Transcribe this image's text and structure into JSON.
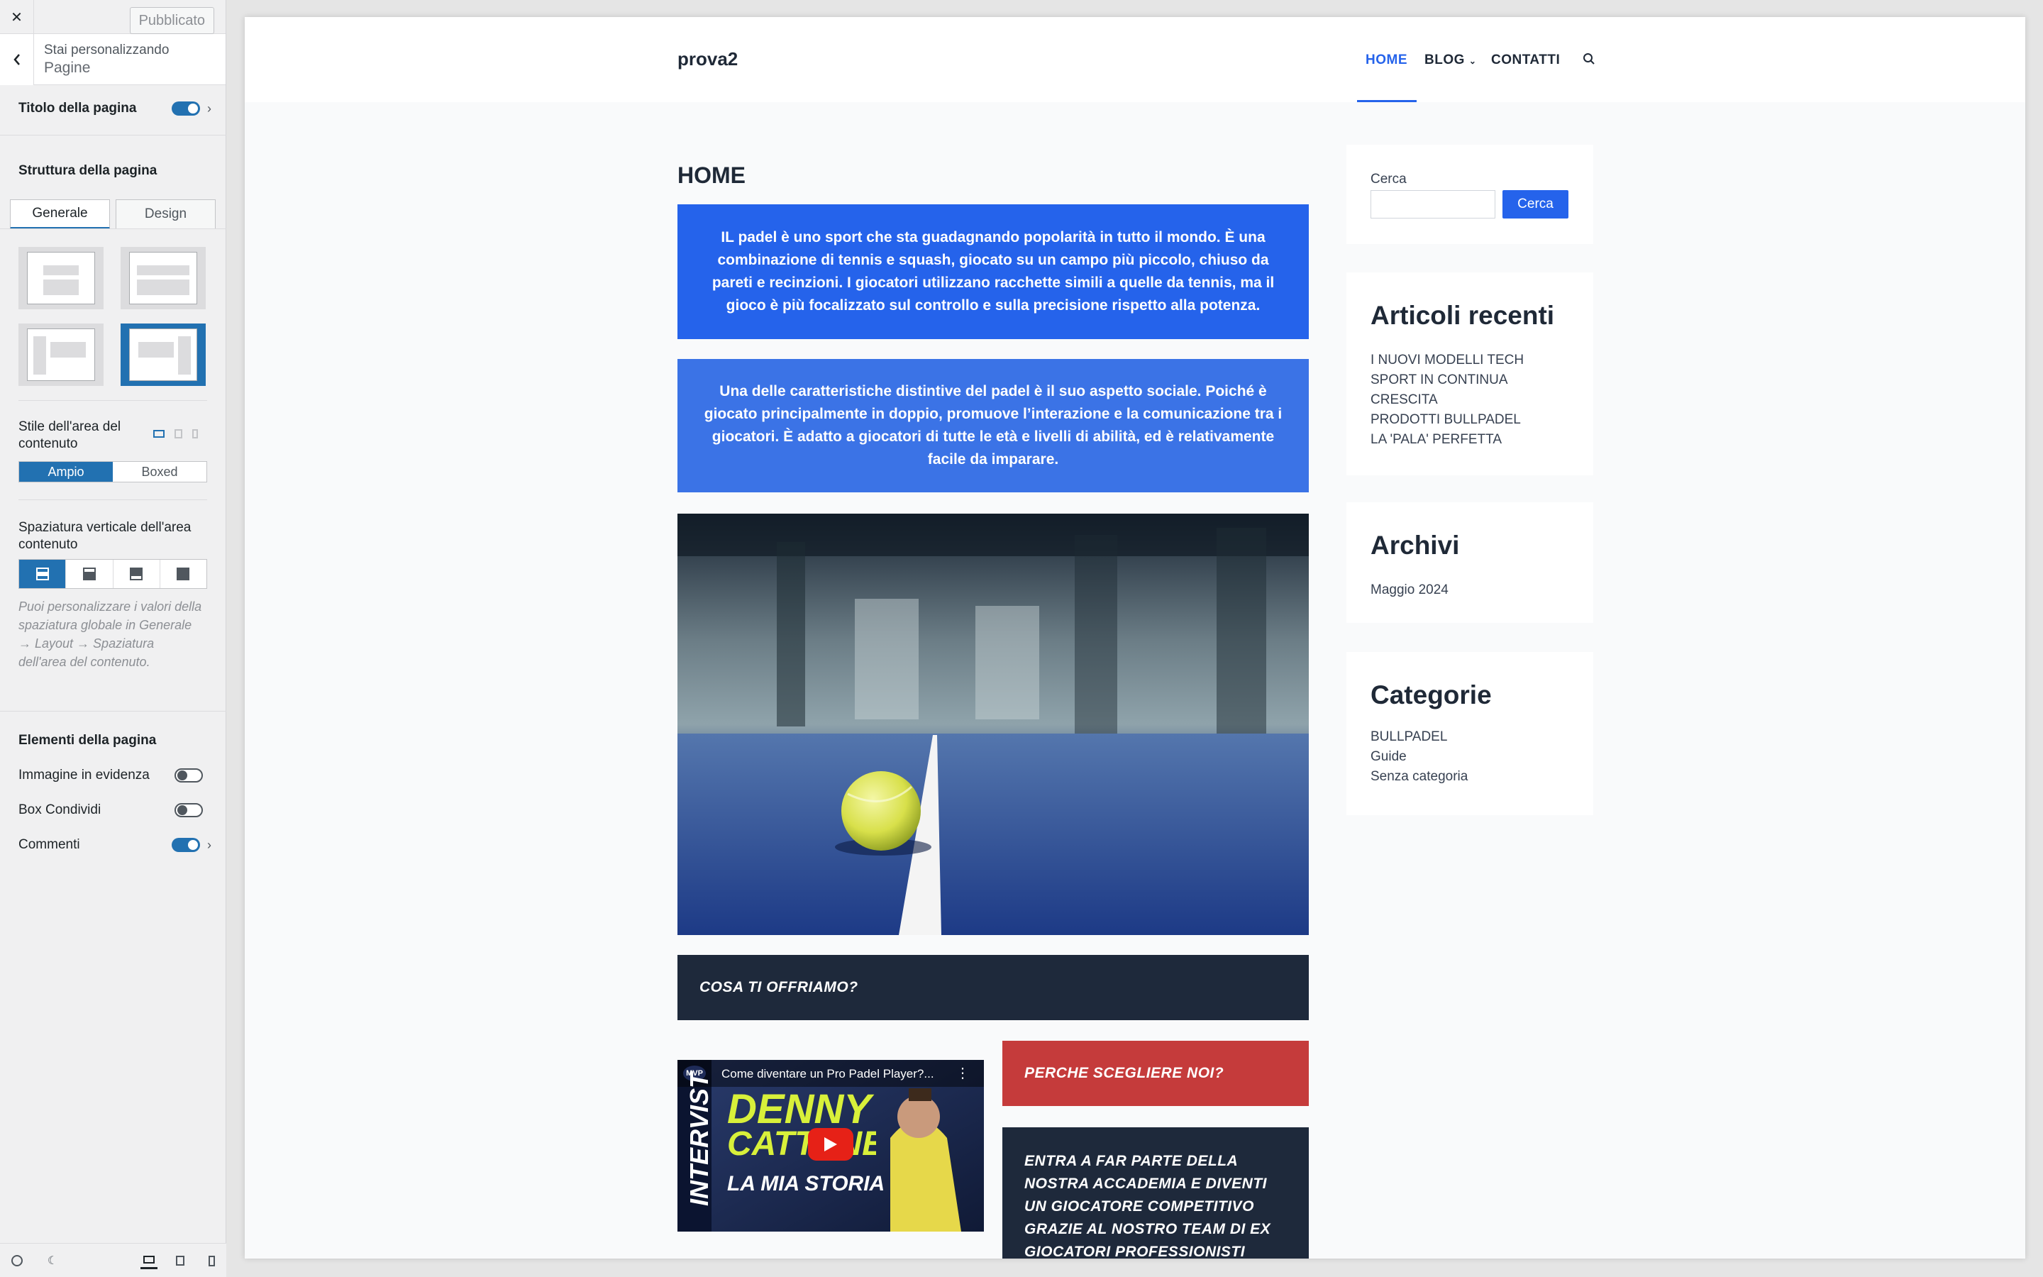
{
  "customizer": {
    "close_icon": "close-icon",
    "publish_label": "Pubblicato",
    "header_subtitle": "Stai personalizzando",
    "header_title": "Pagine",
    "page_title_label": "Titolo della pagina",
    "page_structure_label": "Struttura della pagina",
    "tabs": [
      "Generale",
      "Design"
    ],
    "active_tab": "Generale",
    "layouts": [
      "full-width",
      "full-width-narrow",
      "left-sidebar",
      "right-sidebar"
    ],
    "selected_layout": "right-sidebar",
    "content_style_label": "Stile dell'area del contenuto",
    "content_style_options": [
      "Ampio",
      "Boxed"
    ],
    "content_style_selected": "Ampio",
    "vertical_spacing_label": "Spaziatura verticale dell'area contenuto",
    "vertical_spacing_selected_index": 0,
    "help_text": "Puoi personalizzare i valori della spaziatura globale in Generale → Layout → Spaziatura dell'area del contenuto.",
    "page_elements_label": "Elementi della pagina",
    "elements": [
      {
        "label": "Immagine in evidenza",
        "on": false
      },
      {
        "label": "Box Condividi",
        "on": false
      },
      {
        "label": "Commenti",
        "on": true
      }
    ],
    "accent_color": "#2271b1"
  },
  "site": {
    "brand": "prova2",
    "nav": [
      "HOME",
      "BLOG",
      "CONTATTI"
    ],
    "nav_active": "HOME",
    "accent_color": "#2563eb",
    "page_title": "HOME",
    "paragraph1": "IL padel è uno sport che sta guadagnando popolarità in tutto il mondo. È una combinazione di tennis e squash, giocato su un campo più piccolo, chiuso da pareti e recinzioni. I giocatori utilizzano racchette simili a quelle da tennis, ma il gioco è più focalizzato sul controllo e sulla precisione rispetto alla potenza.",
    "paragraph2": "Una delle caratteristiche distintive del padel è il suo aspetto sociale. Poiché è giocato principalmente in doppio, promuove l’interazione e la comunicazione tra i giocatori. È adatto a giocatori di tutte le età e livelli di abilità, ed è relativamente facile da imparare.",
    "offer_heading": "COSA TI OFFRIAMO?",
    "why_heading": "PERCHE SCEGLIERE NOI?",
    "join_text": "ENTRA A FAR PARTE DELLA NOSTRA ACCADEMIA E DIVENTI UN GIOCATORE COMPETITIVO GRAZIE AL NOSTRO TEAM DI EX GIOCATORI PROFESSIONISTI",
    "video": {
      "title": "Come diventare un Pro Padel Player?...",
      "badge": "MVP",
      "side_text": "INTERVIST",
      "name_line1": "DENNY",
      "name_line2": "CATTANEO",
      "subtitle": "LA MIA STORIA"
    },
    "sidebar": {
      "search_label": "Cerca",
      "search_button": "Cerca",
      "recent_title": "Articoli recenti",
      "recent": [
        "I NUOVI MODELLI TECH",
        "SPORT IN CONTINUA",
        "CRESCITA",
        "PRODOTTI BULLPADEL",
        "LA 'PALA' PERFETTA"
      ],
      "archive_title": "Archivi",
      "archive": [
        "Maggio 2024"
      ],
      "categories_title": "Categorie",
      "categories": [
        "BULLPADEL",
        "Guide",
        "Senza categoria"
      ]
    }
  }
}
